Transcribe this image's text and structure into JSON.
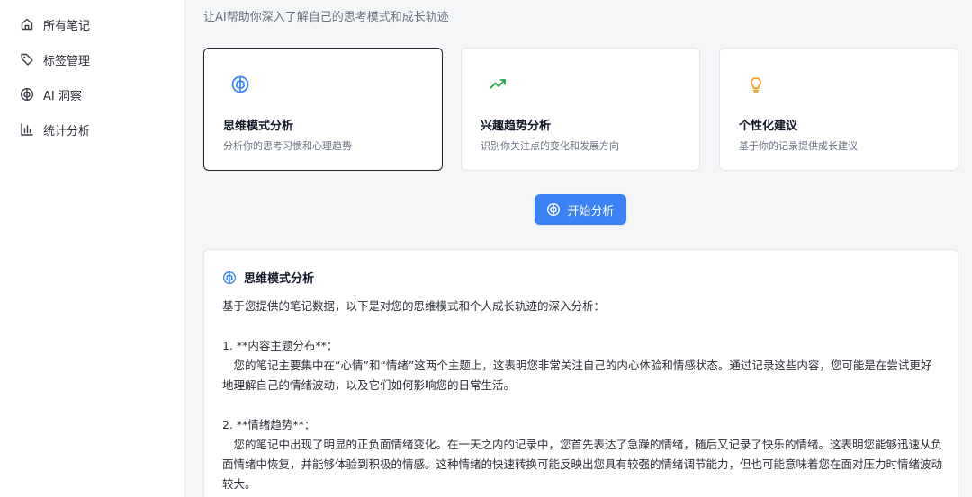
{
  "sidebar": {
    "items": [
      {
        "label": "所有笔记",
        "icon": "home-icon"
      },
      {
        "label": "标签管理",
        "icon": "tag-icon"
      },
      {
        "label": "AI 洞察",
        "icon": "brain-icon"
      },
      {
        "label": "统计分析",
        "icon": "bar-chart-icon"
      }
    ]
  },
  "main": {
    "subtitle": "让AI帮助你深入了解自己的思考模式和成长轨迹",
    "cards": [
      {
        "title": "思维模式分析",
        "desc": "分析你的思考习惯和心理趋势",
        "icon": "brain-icon",
        "icon_color": "#3b82f6",
        "selected": true
      },
      {
        "title": "兴趣趋势分析",
        "desc": "识别你关注点的变化和发展方向",
        "icon": "trending-up-icon",
        "icon_color": "#22a84a",
        "selected": false
      },
      {
        "title": "个性化建议",
        "desc": "基于你的记录提供成长建议",
        "icon": "lightbulb-icon",
        "icon_color": "#f0a020",
        "selected": false
      }
    ],
    "start_button": "开始分析",
    "result": {
      "title": "思维模式分析",
      "intro": "基于您提供的笔记数据，以下是对您的思维模式和个人成长轨迹的深入分析：",
      "s1_heading": "1. **内容主题分布**：",
      "s1_body": "　您的笔记主要集中在“心情”和“情绪”这两个主题上，这表明您非常关注自己的内心体验和情感状态。通过记录这些内容，您可能是在尝试更好地理解自己的情绪波动，以及它们如何影响您的日常生活。",
      "s2_heading": "2. **情绪趋势**：",
      "s2_body": "　您的笔记中出现了明显的正负面情绪变化。在一天之内的记录中，您首先表达了急躁的情绪，随后又记录了快乐的情绪。这表明您能够迅速从负面情绪中恢复，并能够体验到积极的情感。这种情绪的快速转换可能反映出您具有较强的情绪调节能力，但也可能意味着您在面对压力时情绪波动较大。"
    }
  },
  "colors": {
    "accent": "#3b82f6",
    "trend": "#22a84a",
    "bulb": "#f0a020"
  }
}
